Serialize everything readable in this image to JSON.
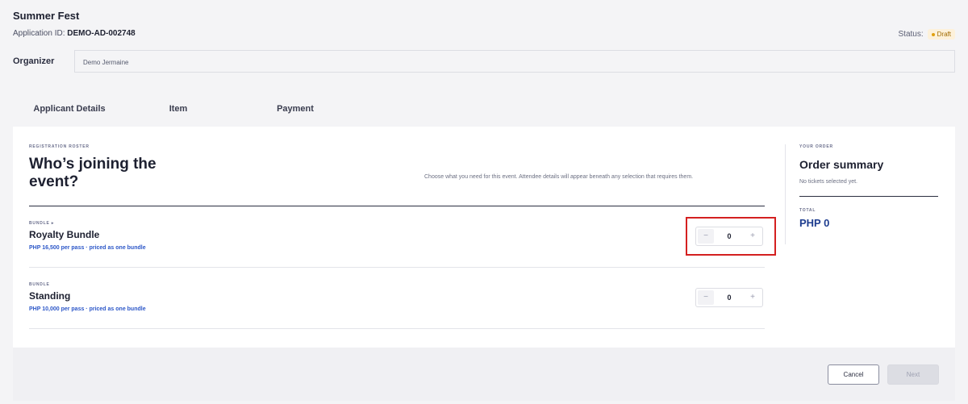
{
  "app": {
    "title": "Summer Fest",
    "application_id_label": "Application ID:",
    "application_id": "DEMO-AD-002748",
    "status_label": "Status:",
    "status_value": "Draft"
  },
  "organizer": {
    "label": "Organizer",
    "value": "Demo Jermaine"
  },
  "tabs": [
    {
      "label": "Applicant Details",
      "active": false
    },
    {
      "label": "Item",
      "active": true
    },
    {
      "label": "Payment",
      "active": false
    }
  ],
  "roster": {
    "kicker": "REGISTRATION ROSTER",
    "title": "Who’s joining the event?",
    "description": "Choose what you need for this event. Attendee details will appear beneath any selection that requires them."
  },
  "items": [
    {
      "kicker": "BUNDLE ▸",
      "name": "Royalty Bundle",
      "price": "PHP 16,500 per pass · priced as one bundle",
      "quantity": "0"
    },
    {
      "kicker": "BUNDLE",
      "name": "Standing",
      "price": "PHP 10,000 per pass · priced as one bundle",
      "quantity": "0"
    }
  ],
  "stepper": {
    "minus": "−",
    "plus": "+"
  },
  "order": {
    "kicker": "YOUR ORDER",
    "title": "Order summary",
    "empty_text": "No tickets selected yet.",
    "total_label": "TOTAL",
    "total_value": "PHP 0"
  },
  "footer": {
    "cancel_label": "Cancel",
    "next_label": "Next"
  },
  "colors": {
    "accent": "#2c57c8",
    "total": "#1e3d8f",
    "highlight": "#d42020",
    "draft_badge": "#fdf1da"
  }
}
